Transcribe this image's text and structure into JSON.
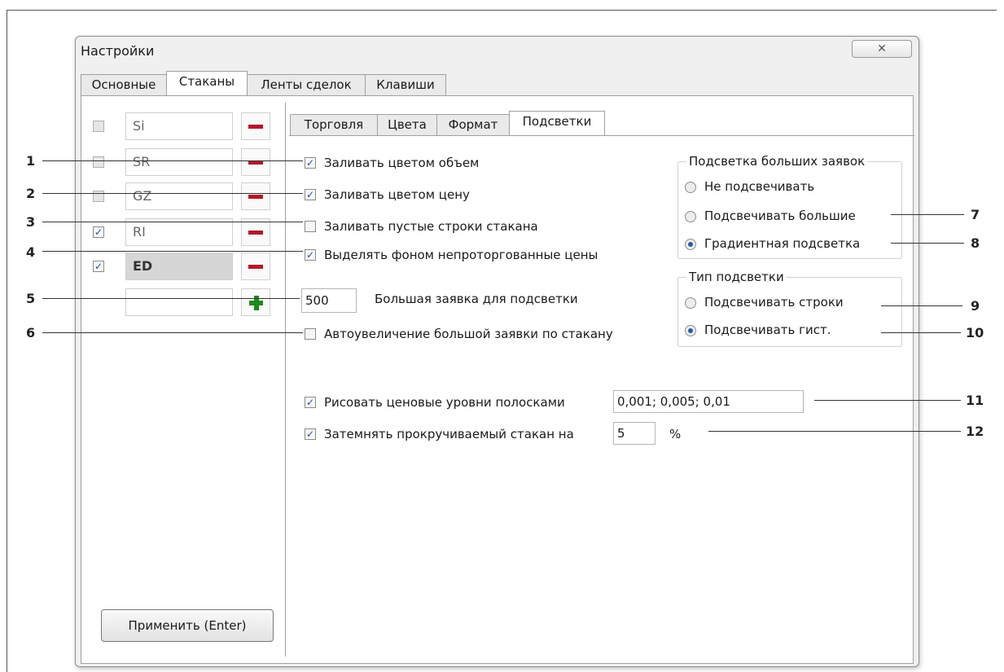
{
  "window": {
    "title": "Настройки",
    "close_glyph": "✕"
  },
  "main_tabs": [
    "Основные",
    "Стаканы",
    "Ленты сделок",
    "Клавиши"
  ],
  "instruments": [
    {
      "name": "Si",
      "checked": false
    },
    {
      "name": "SR",
      "checked": false
    },
    {
      "name": "GZ",
      "checked": false
    },
    {
      "name": "RI",
      "checked": true
    },
    {
      "name": "ED",
      "checked": true
    }
  ],
  "new_instrument_value": "",
  "apply_button": "Применить (Enter)",
  "sub_tabs": [
    "Торговля",
    "Цвета",
    "Формат",
    "Подсветки"
  ],
  "options": {
    "fill_volume": "Заливать цветом объем",
    "fill_price": "Заливать цветом цену",
    "fill_empty": "Заливать пустые строки стакана",
    "highlight_untraded": "Выделять фоном непроторгованные  цены",
    "large_order_value": "500",
    "large_order_label": "Большая заявка для подсветки",
    "auto_increase": "Автоувеличение большой заявки по стакану",
    "price_levels_label": "Рисовать ценовые уровни полосками",
    "price_levels_value": "0,001; 0,005; 0,01",
    "darken_label": "Затемнять прокручиваемый стакан на",
    "darken_value": "5",
    "darken_unit": "%"
  },
  "large_orders_group": {
    "title": "Подсветка больших заявок",
    "items": [
      "Не подсвечивать",
      "Подсвечивать большие",
      "Градиентная подсветка"
    ],
    "selected": 2
  },
  "highlight_type_group": {
    "title": "Тип подсветки",
    "items": [
      "Подсвечивать строки",
      "Подсвечивать гист."
    ],
    "selected": 1
  },
  "annotations": [
    "1",
    "2",
    "3",
    "4",
    "5",
    "6",
    "7",
    "8",
    "9",
    "10",
    "11",
    "12"
  ],
  "colors": {
    "minus": "#b2182b",
    "plus": "#1e8a1e",
    "check": "#2a4c9a"
  }
}
